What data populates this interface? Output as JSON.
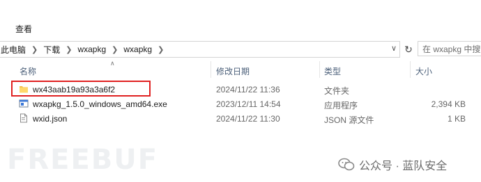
{
  "ribbon": {
    "view_label": "查看"
  },
  "address_bar": {
    "crumbs": [
      {
        "label": "此电脑"
      },
      {
        "label": "下载"
      },
      {
        "label": "wxapkg"
      },
      {
        "label": "wxapkg"
      }
    ]
  },
  "search": {
    "placeholder": "在 wxapkg 中搜"
  },
  "columns": {
    "name": "名称",
    "modified": "修改日期",
    "type": "类型",
    "size": "大小"
  },
  "files": [
    {
      "name": "wx43aab19a93a3a6f2",
      "modified": "2024/11/22 11:36",
      "type": "文件夹",
      "size": "",
      "icon": "folder-icon"
    },
    {
      "name": "wxapkg_1.5.0_windows_amd64.exe",
      "modified": "2023/12/11 14:54",
      "type": "应用程序",
      "size": "2,394 KB",
      "icon": "exe-icon"
    },
    {
      "name": "wxid.json",
      "modified": "2024/11/22 11:30",
      "type": "JSON 源文件",
      "size": "1 KB",
      "icon": "json-file-icon"
    }
  ],
  "watermark": {
    "text": "FREEBUF"
  },
  "wechat": {
    "label": "公众号 · 蓝队安全"
  },
  "colors": {
    "highlight": "#e02020",
    "header_text": "#4c607a",
    "folder": "#f4c24d"
  }
}
